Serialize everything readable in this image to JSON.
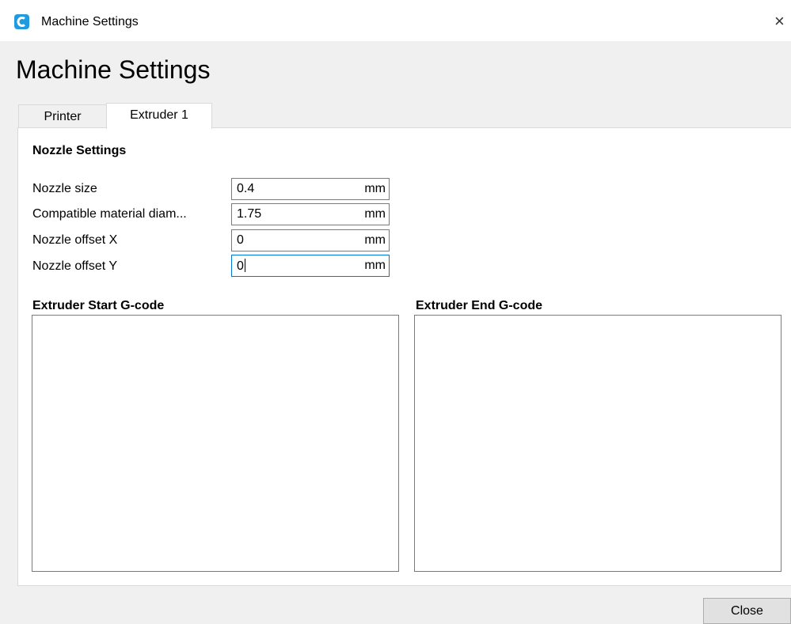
{
  "window": {
    "title": "Machine Settings",
    "app_icon": "cura-logo-icon",
    "close_glyph": "×"
  },
  "dialog": {
    "heading": "Machine Settings",
    "tabs": [
      {
        "label": "Printer",
        "selected": false
      },
      {
        "label": "Extruder 1",
        "selected": true
      }
    ]
  },
  "nozzle": {
    "section_title": "Nozzle Settings",
    "fields": [
      {
        "label": "Nozzle size",
        "value": "0.4",
        "unit": "mm"
      },
      {
        "label": "Compatible material diam...",
        "value": "1.75",
        "unit": "mm"
      },
      {
        "label": "Nozzle offset X",
        "value": "0",
        "unit": "mm"
      },
      {
        "label": "Nozzle offset Y",
        "value": "0",
        "unit": "mm",
        "focused": true
      }
    ]
  },
  "gcode": {
    "start_title": "Extruder Start G-code",
    "start_value": "",
    "end_title": "Extruder End G-code",
    "end_value": ""
  },
  "footer": {
    "close_label": "Close"
  },
  "colors": {
    "accent": "#1f9bde",
    "focus_border": "#0078d7",
    "dialog_bg": "#f0f0f0"
  }
}
